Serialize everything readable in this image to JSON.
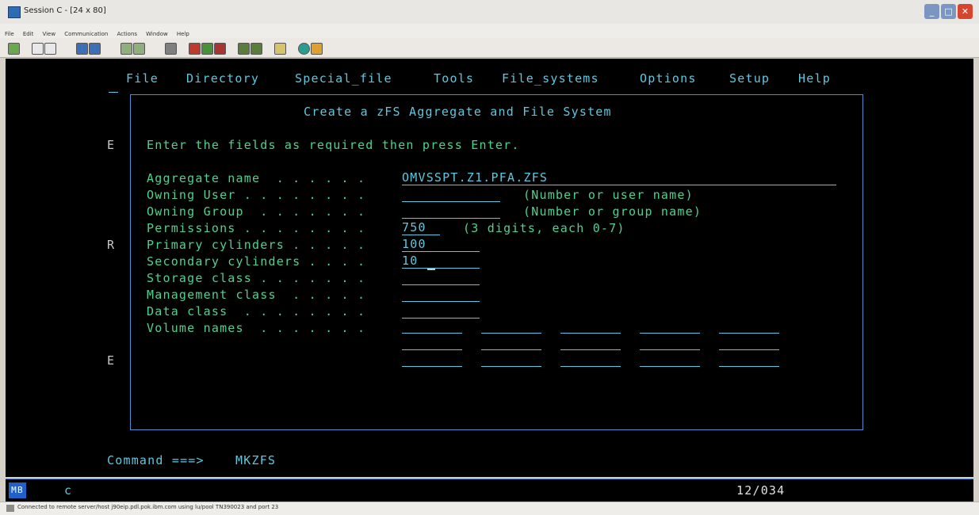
{
  "window": {
    "title": "Session C - [24 x 80]",
    "menus": [
      "File",
      "Edit",
      "View",
      "Communication",
      "Actions",
      "Window",
      "Help"
    ]
  },
  "toolbar_icons": [
    "print-icon",
    "copy-icon",
    "paste-icon",
    "send-icon",
    "receive-icon",
    "display-icon",
    "keyboard-icon",
    "mouse-icon",
    "macro-record-icon",
    "macro-play-icon",
    "macro-stop-icon",
    "transfer-send-icon",
    "transfer-receive-icon",
    "color-icon",
    "support-icon",
    "help-icon"
  ],
  "terminal": {
    "menu": [
      "File",
      "Directory",
      "Special_file",
      "Tools",
      "File_systems",
      "Options",
      "Setup",
      "Help"
    ],
    "panel_title": "Create a zFS Aggregate and File System",
    "instructions": "Enter the fields as required then press Enter.",
    "side_letters": [
      "E",
      "R",
      "E"
    ],
    "fields": [
      {
        "label": "Aggregate name  . . . . . .",
        "value": "OMVSSPT.Z1.PFA.ZFS",
        "hint": ""
      },
      {
        "label": "Owning User . . . . . . . .",
        "value": "",
        "hint": "(Number or user name)"
      },
      {
        "label": "Owning Group  . . . . . . .",
        "value": "",
        "hint": "(Number or group name)"
      },
      {
        "label": "Permissions . . . . . . . .",
        "value": "750",
        "hint": "(3 digits, each 0-7)"
      },
      {
        "label": "Primary cylinders . . . . .",
        "value": "100",
        "hint": ""
      },
      {
        "label": "Secondary cylinders . . . .",
        "value": "10",
        "hint": ""
      },
      {
        "label": "Storage class . . . . . . .",
        "value": "",
        "hint": ""
      },
      {
        "label": "Management class  . . . . .",
        "value": "",
        "hint": ""
      },
      {
        "label": "Data class  . . . . . . . .",
        "value": "",
        "hint": ""
      },
      {
        "label": "Volume names  . . . . . . .",
        "value": "",
        "hint": ""
      }
    ],
    "command_label": "Command ===>",
    "command_value": "MKZFS"
  },
  "statusline": {
    "indicator": "MB",
    "mode": "c",
    "cursor_pos": "12/034"
  },
  "bottom_status": "Connected to remote server/host j90eip.pdl.pok.ibm.com using lu/pool TN390023 and port 23",
  "colors": {
    "terminal_bg": "#000000",
    "field_green": "#4fd28f",
    "field_cyan": "#5fc8e0",
    "border_blue": "#4a8fd6"
  }
}
